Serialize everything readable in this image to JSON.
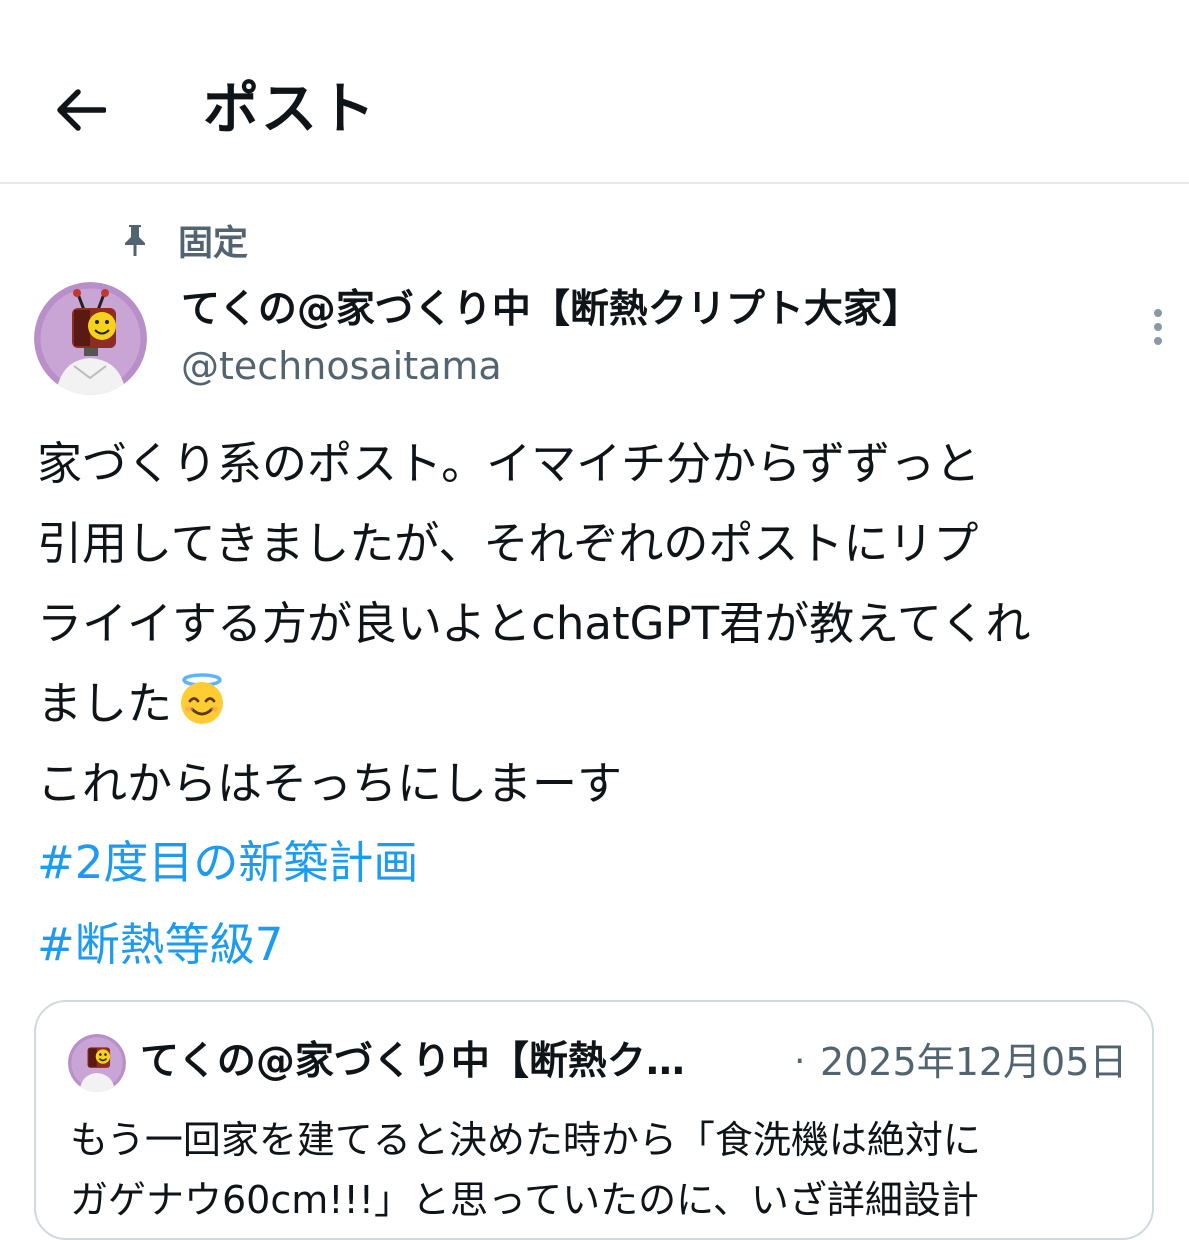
{
  "header": {
    "title": "ポスト"
  },
  "post": {
    "pinned_label": "固定",
    "author": {
      "display_name": "てくの@家づくり中【断熱クリプト大家】",
      "handle": "@technosaitama"
    },
    "body_lines": [
      "家づくり系のポスト。イマイチ分からずずっと",
      "引用してきましたが、それぞれのポストにリプ",
      "ライイする方が良いよとchatGPT君が教えてくれ",
      "ました",
      "これからはそっちにしまーす"
    ],
    "hashtags": [
      "#2度目の新築計画",
      "#断熱等級7"
    ]
  },
  "quote": {
    "display_name": "てくの@家づくり中【断熱ク…",
    "separator": "·",
    "date": "2025年12月05日",
    "text_lines": [
      "もう一回家を建てると決めた時から「食洗機は絶対に",
      "ガゲナウ60cm!!!」と思っていたのに、いざ詳細設計"
    ]
  },
  "colors": {
    "link": "#1d9bf0",
    "secondary_text": "#536471",
    "border": "#cfd9de"
  },
  "icons": {
    "back": "back-arrow-icon",
    "pin": "pin-icon",
    "more": "more-vertical-icon",
    "emoji": "smiling-face-with-halo"
  }
}
